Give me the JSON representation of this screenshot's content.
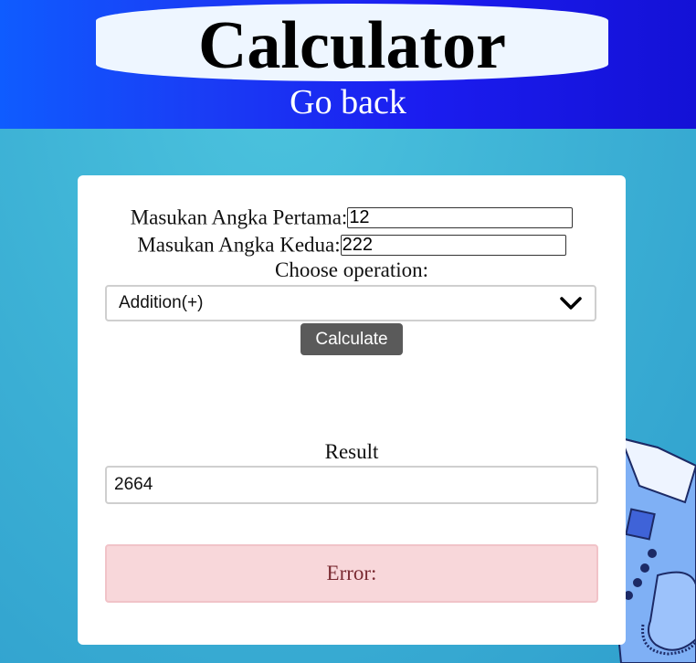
{
  "header": {
    "title": "Calculator",
    "go_back": "Go back"
  },
  "form": {
    "first_label": "Masukan Angka Pertama:",
    "first_value": "12",
    "second_label": "Masukan Angka Kedua:",
    "second_value": "222",
    "operation_label": "Choose operation:",
    "operation_selected": "Addition(+)",
    "calculate_label": "Calculate"
  },
  "result": {
    "label": "Result",
    "value": "2664"
  },
  "error": {
    "text": "Error:"
  },
  "colors": {
    "header_start": "#0f5cff",
    "header_end": "#1411d6",
    "background": "#3eb3d6",
    "button": "#5a5a5a",
    "error_bg": "#f8d7da"
  },
  "icons": {
    "select_arrow": "chevron-down-icon",
    "decoration": "fax-phone-icon"
  }
}
